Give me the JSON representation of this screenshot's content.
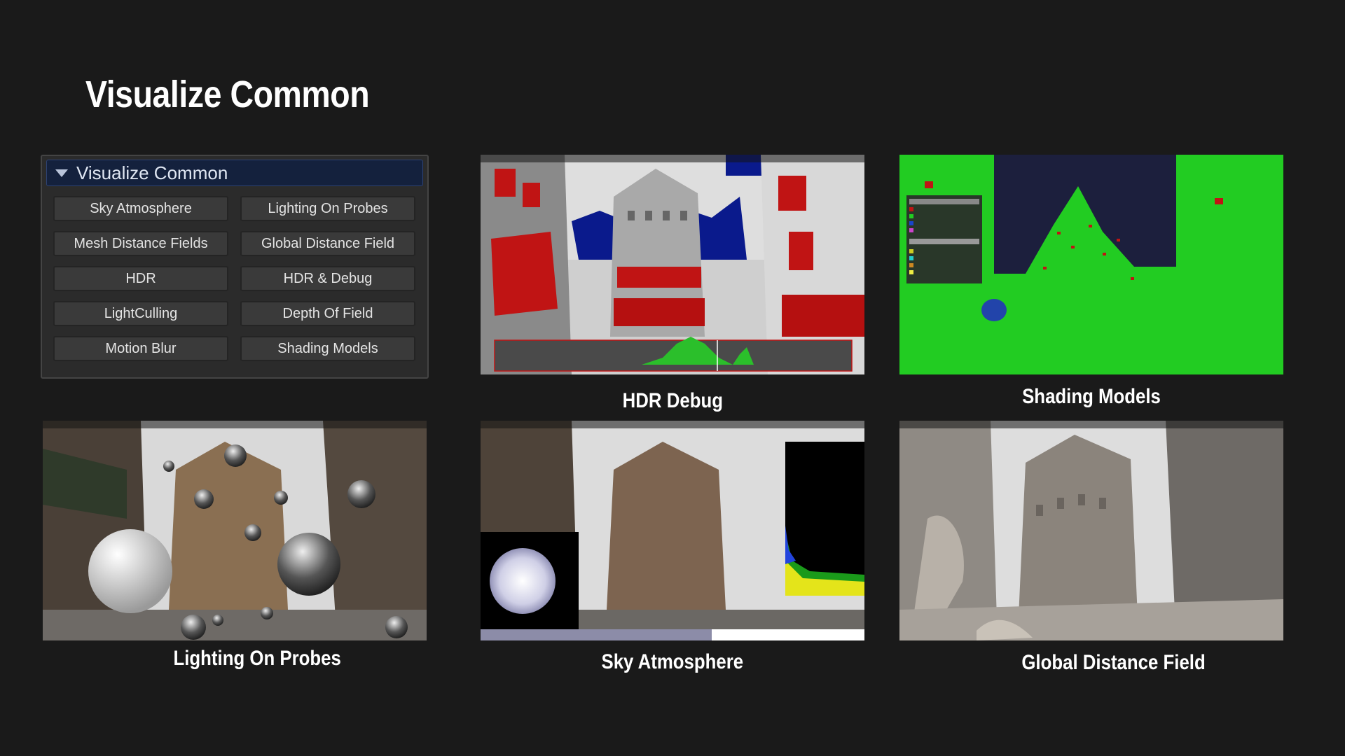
{
  "title": "Visualize Common",
  "panel": {
    "header": "Visualize Common",
    "buttons": [
      "Sky Atmosphere",
      "Lighting On Probes",
      "Mesh Distance Fields",
      "Global Distance Field",
      "HDR",
      "HDR & Debug",
      "LightCulling",
      "Depth Of Field",
      "Motion Blur",
      "Shading Models"
    ]
  },
  "captions": {
    "hdr_debug": "HDR Debug",
    "shading_models": "Shading Models",
    "lighting_on_probes": "Lighting On Probes",
    "sky_atmosphere": "Sky Atmosphere",
    "global_distance_field": "Global Distance Field"
  },
  "colors": {
    "background": "#1a1a1a",
    "panel_header": "#14213d",
    "shading_green": "#22cc22",
    "hdr_blue": "#0a1a8c",
    "hdr_red": "#cc1111"
  }
}
